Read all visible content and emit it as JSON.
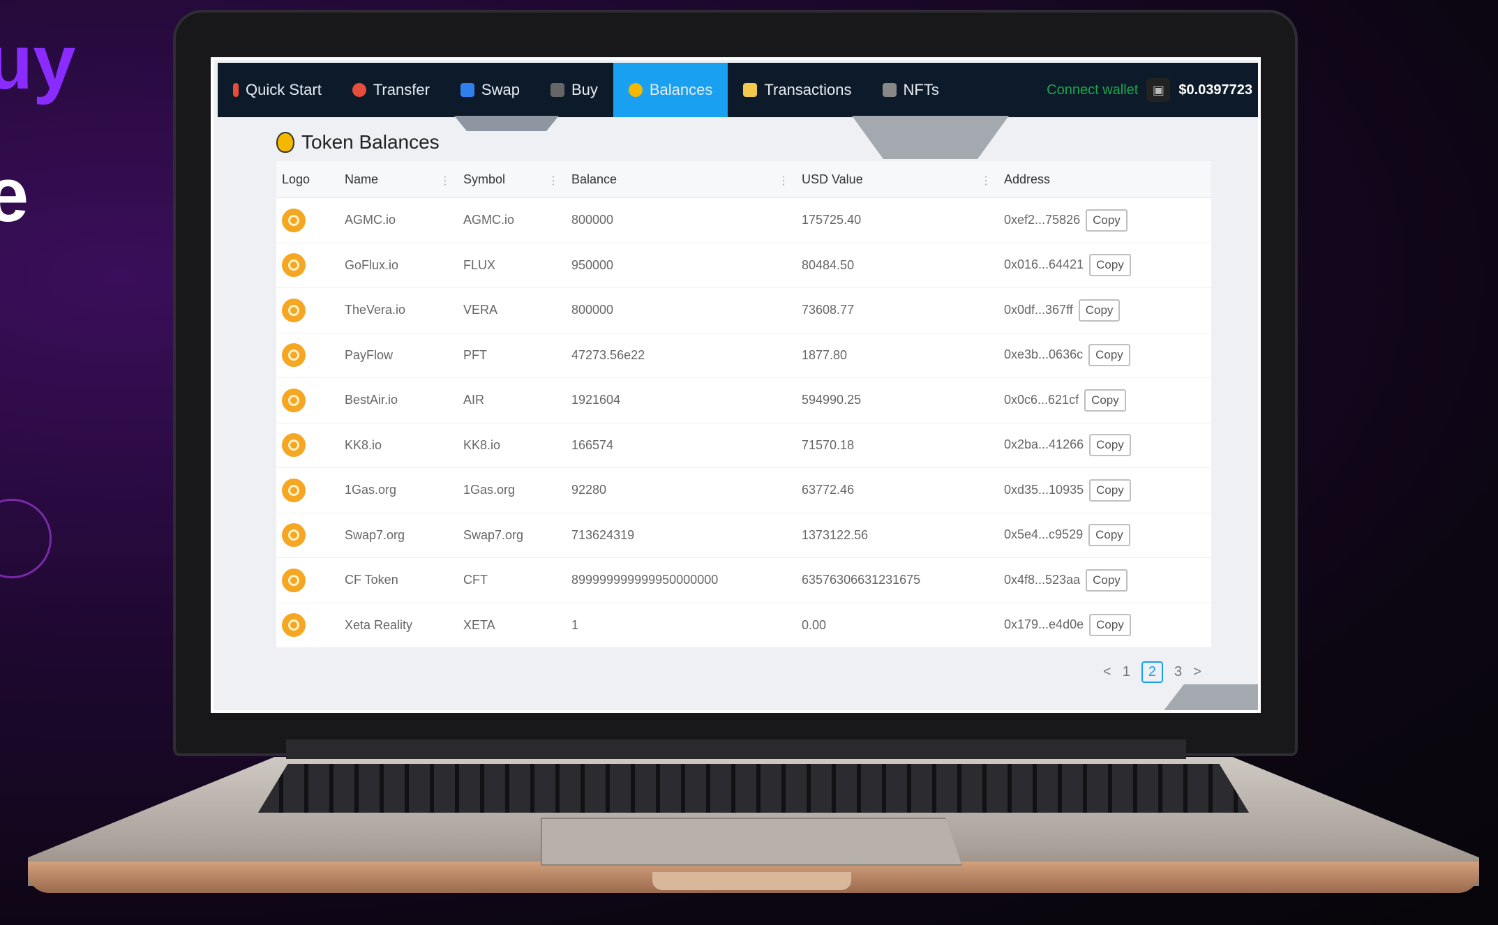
{
  "hero": {
    "line1": "uy",
    "line2": "e"
  },
  "nav": {
    "tabs": [
      {
        "label": "Quick Start",
        "icon": "rocket-icon",
        "color": "#e74c3c"
      },
      {
        "label": "Transfer",
        "icon": "transfer-icon",
        "color": "#e74c3c"
      },
      {
        "label": "Swap",
        "icon": "swap-icon",
        "color": "#2f80ed"
      },
      {
        "label": "Buy",
        "icon": "buy-icon",
        "color": "#888888"
      },
      {
        "label": "Balances",
        "icon": "coin-bag-icon",
        "color": "#f5b800"
      },
      {
        "label": "Transactions",
        "icon": "transactions-icon",
        "color": "#f2c94c"
      },
      {
        "label": "NFTs",
        "icon": "nft-icon",
        "color": "#888888"
      }
    ],
    "connect_wallet": "Connect wallet",
    "price": "$0.0397723"
  },
  "page": {
    "title": "Token Balances"
  },
  "table": {
    "headers": [
      "Logo",
      "Name",
      "Symbol",
      "Balance",
      "USD Value",
      "Address"
    ],
    "copy_label": "Copy",
    "rows": [
      {
        "name": "AGMC.io",
        "symbol": "AGMC.io",
        "balance": "800000",
        "usd": "175725.40",
        "address": "0xef2...75826"
      },
      {
        "name": "GoFlux.io",
        "symbol": "FLUX",
        "balance": "950000",
        "usd": "80484.50",
        "address": "0x016...64421"
      },
      {
        "name": "TheVera.io",
        "symbol": "VERA",
        "balance": "800000",
        "usd": "73608.77",
        "address": "0x0df...367ff"
      },
      {
        "name": "PayFlow",
        "symbol": "PFT",
        "balance": "47273.56e22",
        "usd": "1877.80",
        "address": "0xe3b...0636c"
      },
      {
        "name": "BestAir.io",
        "symbol": "AIR",
        "balance": "1921604",
        "usd": "594990.25",
        "address": "0x0c6...621cf"
      },
      {
        "name": "KK8.io",
        "symbol": "KK8.io",
        "balance": "166574",
        "usd": "71570.18",
        "address": "0x2ba...41266"
      },
      {
        "name": "1Gas.org",
        "symbol": "1Gas.org",
        "balance": "92280",
        "usd": "63772.46",
        "address": "0xd35...10935"
      },
      {
        "name": "Swap7.org",
        "symbol": "Swap7.org",
        "balance": "713624319",
        "usd": "1373122.56",
        "address": "0x5e4...c9529"
      },
      {
        "name": "CF Token",
        "symbol": "CFT",
        "balance": "899999999999950000000",
        "usd": "63576306631231675",
        "address": "0x4f8...523aa"
      },
      {
        "name": "Xeta Reality",
        "symbol": "XETA",
        "balance": "1",
        "usd": "0.00",
        "address": "0x179...e4d0e"
      }
    ]
  },
  "pagination": {
    "prev": "<",
    "pages": [
      "1",
      "2",
      "3"
    ],
    "current": "2",
    "next": ">"
  }
}
